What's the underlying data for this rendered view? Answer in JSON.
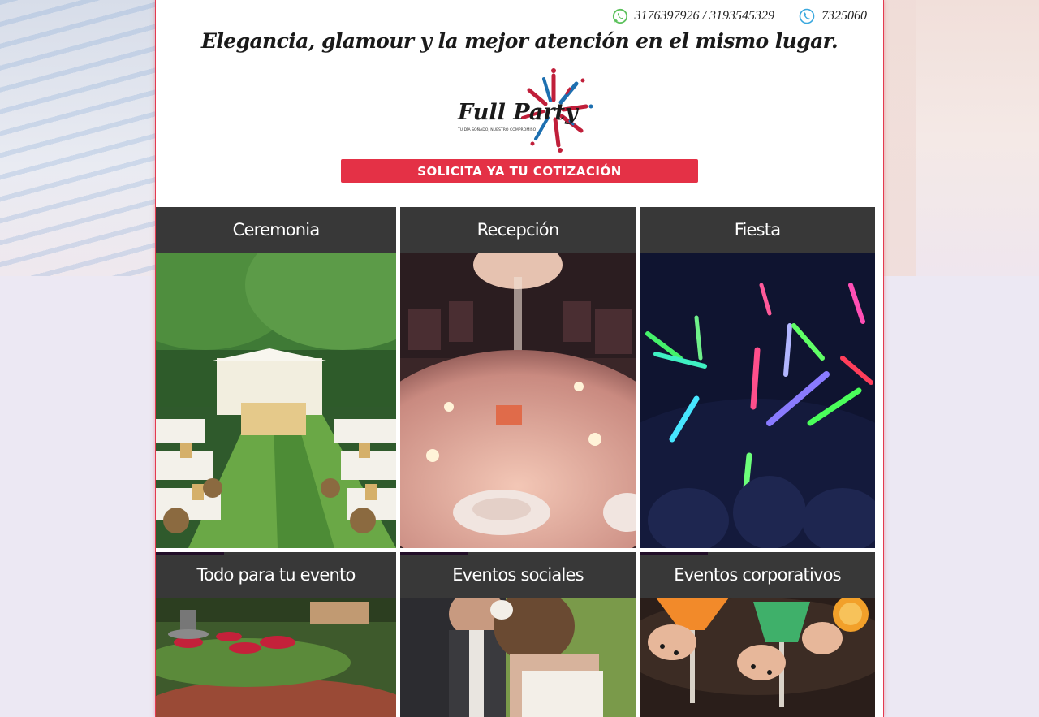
{
  "header": {
    "whatsapp_icon": "whatsapp-icon",
    "mobiles": "3176397926 / 3193545329",
    "phone_icon": "phone-icon",
    "landline": "7325060",
    "tagline": "Elegancia, glamour y la mejor atención en el mismo lugar.",
    "logo": {
      "brand": "Full Party",
      "slogan": "TU DÍA SOÑADO, NUESTRO COMPROMISO"
    },
    "cta_label": "SOLICITA YA TU COTIZACIÓN"
  },
  "colors": {
    "cta": "#e43146",
    "accent_bar": "#9b3fb7",
    "border": "#e33a4f"
  },
  "tiles": [
    {
      "label": "Ceremonia"
    },
    {
      "label": "Recepción"
    },
    {
      "label": "Fiesta"
    },
    {
      "label": "Todo para tu evento"
    },
    {
      "label": "Eventos sociales"
    },
    {
      "label": "Eventos corporativos"
    }
  ]
}
